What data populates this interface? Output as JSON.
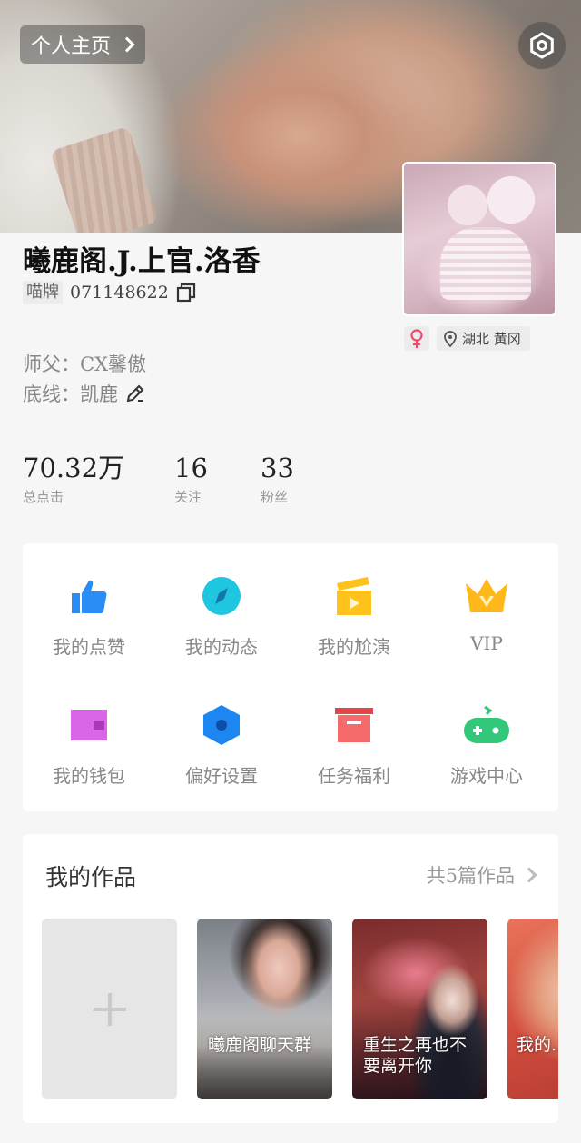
{
  "header": {
    "home_label": "个人主页"
  },
  "profile": {
    "username": "曦鹿阁.J.上官.洛香",
    "id_badge": "喵牌",
    "id_number": "071148622",
    "master_line": "师父：CX馨傲",
    "bottom_line": "底线：凯鹿",
    "gender_icon": "female-icon",
    "location": "湖北 黄冈"
  },
  "stats": [
    {
      "value": "70.32万",
      "label": "总点击"
    },
    {
      "value": "16",
      "label": "关注"
    },
    {
      "value": "33",
      "label": "粉丝"
    }
  ],
  "menu": [
    {
      "label": "我的点赞",
      "icon": "thumbs-up-icon",
      "color": "#2a8cf5"
    },
    {
      "label": "我的动态",
      "icon": "compass-icon",
      "color": "#1ec6e0"
    },
    {
      "label": "我的尬演",
      "icon": "clapperboard-icon",
      "color": "#ffc21a"
    },
    {
      "label": "VIP",
      "icon": "crown-icon",
      "color": "#ffb81a"
    },
    {
      "label": "我的钱包",
      "icon": "wallet-icon",
      "color": "#d966e8"
    },
    {
      "label": "偏好设置",
      "icon": "hexagon-settings-icon",
      "color": "#1d86f0"
    },
    {
      "label": "任务福利",
      "icon": "gift-box-icon",
      "color": "#f05454"
    },
    {
      "label": "游戏中心",
      "icon": "gamepad-icon",
      "color": "#33c77a"
    }
  ],
  "works": {
    "title": "我的作品",
    "count_label": "共5篇作品",
    "items": [
      {
        "title": "曦鹿阁聊天群"
      },
      {
        "title": "重生之再也不要离开你"
      },
      {
        "title": "我的..."
      }
    ]
  }
}
